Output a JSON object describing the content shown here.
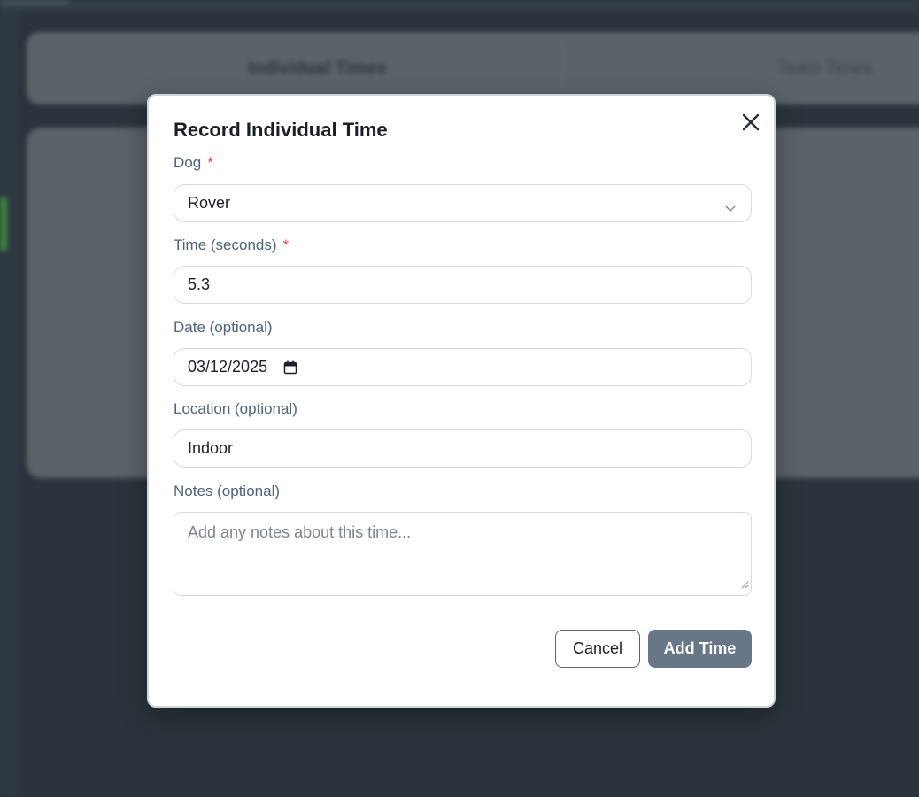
{
  "background": {
    "tabs": [
      "Individual Times",
      "Team Times"
    ]
  },
  "modal": {
    "title": "Record Individual Time",
    "close_icon": "close-icon",
    "fields": {
      "dog": {
        "label": "Dog",
        "required_mark": "*",
        "value": "Rover"
      },
      "time": {
        "label": "Time (seconds)",
        "required_mark": "*",
        "value": "5.3"
      },
      "date": {
        "label": "Date (optional)",
        "value": "03/12/2025",
        "icon": "calendar-icon"
      },
      "location": {
        "label": "Location (optional)",
        "value": "Indoor"
      },
      "notes": {
        "label": "Notes (optional)",
        "placeholder": "Add any notes about this time..."
      }
    },
    "buttons": {
      "cancel": "Cancel",
      "add": "Add Time"
    }
  },
  "colors": {
    "overlay": "#2b343c",
    "primary_button": "#677788",
    "required": "#e0443f",
    "label": "#4f6478"
  }
}
